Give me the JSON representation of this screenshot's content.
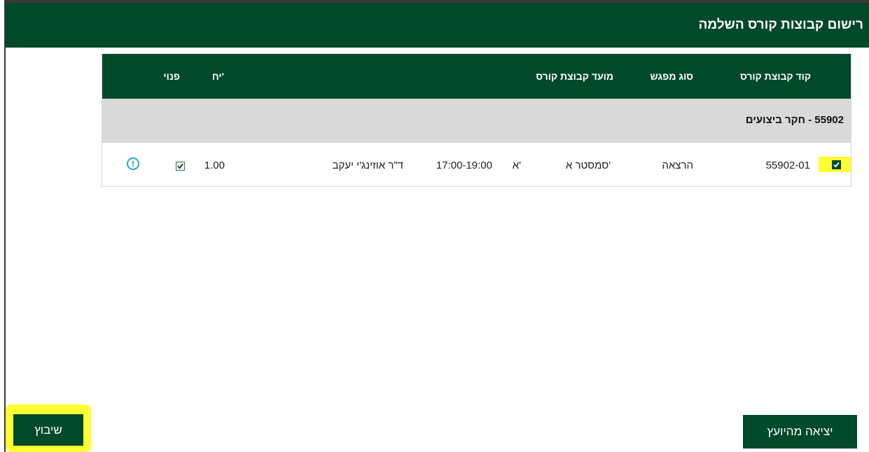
{
  "dialog": {
    "title": "רישום קבוצות קורס השלמה"
  },
  "grid": {
    "columns": {
      "code": "קוד קבוצת קורס",
      "meeting_type": "סוג מפגש",
      "schedule": "מועד קבוצת קורס",
      "credits": "יח'",
      "available": "פנוי"
    },
    "group": {
      "label": "55902 - חקר ביצועים"
    },
    "rows": [
      {
        "code": "55902-01",
        "meeting_type": "הרצאה",
        "semester": "סמסטר א'",
        "day": "א'",
        "time": "17:00-19:00",
        "lecturer": "ד\"ר אוזינג'י יעקב",
        "credits": "1.00",
        "selected": true,
        "available": true
      }
    ]
  },
  "buttons": {
    "exit_advisor": "יציאה מהיועץ",
    "assign": "שיבוץ"
  },
  "colors": {
    "brand_green": "#00492b",
    "highlight_yellow": "#ffff33",
    "info_blue": "#2aa6d8"
  }
}
